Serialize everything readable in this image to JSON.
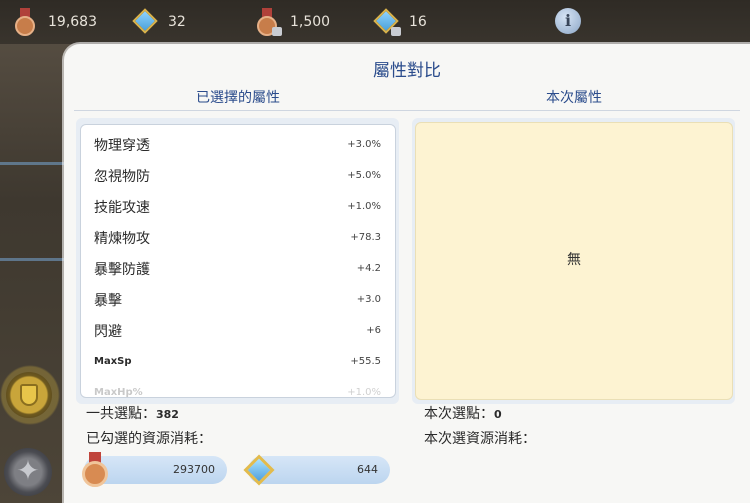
{
  "resources": [
    {
      "icon": "medal-icon",
      "value": "19,683"
    },
    {
      "icon": "gem-icon",
      "value": "32"
    },
    {
      "icon": "medal-lock-icon",
      "value": "1,500"
    },
    {
      "icon": "gem-lock-icon",
      "value": "16"
    }
  ],
  "info_label": "i",
  "dialog": {
    "title": "屬性對比",
    "left_header": "已選擇的屬性",
    "right_header": "本次屬性",
    "attributes": [
      {
        "name": "物理穿透",
        "value": "+3.0%"
      },
      {
        "name": "忽視物防",
        "value": "+5.0%"
      },
      {
        "name": "技能攻速",
        "value": "+1.0%"
      },
      {
        "name": "精煉物攻",
        "value": "+78.3"
      },
      {
        "name": "暴擊防護",
        "value": "+4.2"
      },
      {
        "name": "暴擊",
        "value": "+3.0"
      },
      {
        "name": "閃避",
        "value": "+6"
      },
      {
        "name": "MaxSp",
        "value": "+55.5"
      },
      {
        "name": "MaxHp%",
        "value": "+1.0%"
      }
    ],
    "empty_text": "無",
    "total_points_label": "一共選點：",
    "total_points_value": "382",
    "checked_cost_label": "已勾選的資源消耗：",
    "current_points_label": "本次選點：",
    "current_points_value": "0",
    "current_cost_label": "本次選資源消耗：",
    "costs": [
      {
        "icon": "medal-icon",
        "amount": "293700"
      },
      {
        "icon": "gem-icon",
        "amount": "644"
      }
    ]
  },
  "colors": {
    "accent": "#2b4c8c",
    "empty_panel": "#fdf3d2",
    "cost_pill": "#c6dcf2"
  }
}
